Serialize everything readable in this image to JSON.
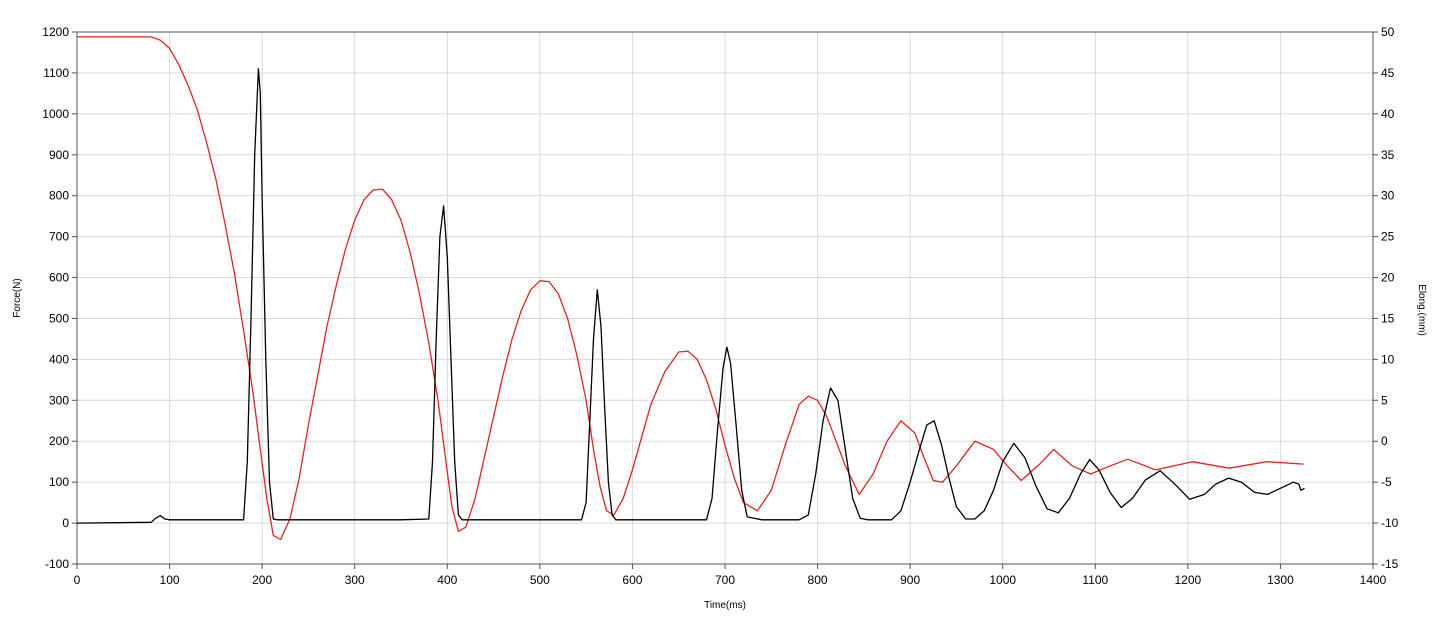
{
  "chart_data": {
    "type": "line",
    "title": "",
    "xlabel": "Time(ms)",
    "ylabel": "Force(N)",
    "y2label": "Elong.(mm)",
    "xlim": [
      0,
      1400
    ],
    "ylim": [
      -100,
      1200
    ],
    "y2lim": [
      -15,
      50
    ],
    "x_ticks": [
      "0",
      "100",
      "200",
      "300",
      "400",
      "500",
      "600",
      "700",
      "800",
      "900",
      "1000",
      "1100",
      "1200",
      "1300",
      "1400"
    ],
    "y_ticks": [
      "-100",
      "0",
      "100",
      "200",
      "300",
      "400",
      "500",
      "600",
      "700",
      "800",
      "900",
      "1000",
      "1100",
      "1200"
    ],
    "y2_ticks": [
      "-15",
      "-10",
      "-5",
      "0",
      "5",
      "10",
      "15",
      "20",
      "25",
      "30",
      "35",
      "40",
      "45",
      "50"
    ],
    "grid": true,
    "legend": "none",
    "series": [
      {
        "axis": "left",
        "color": "#000000",
        "x": [
          0,
          80,
          85,
          90,
          95,
          100,
          150,
          180,
          184,
          188,
          192,
          196,
          198,
          200,
          204,
          208,
          212,
          216,
          250,
          300,
          350,
          380,
          384,
          388,
          392,
          396,
          400,
          404,
          408,
          412,
          416,
          450,
          500,
          545,
          550,
          554,
          558,
          562,
          566,
          570,
          574,
          578,
          582,
          600,
          640,
          680,
          686,
          692,
          698,
          702,
          706,
          712,
          718,
          724,
          740,
          780,
          790,
          798,
          806,
          814,
          822,
          830,
          838,
          846,
          854,
          880,
          890,
          900,
          910,
          918,
          926,
          934,
          942,
          950,
          960,
          970,
          980,
          990,
          1000,
          1012,
          1024,
          1036,
          1048,
          1060,
          1072,
          1084,
          1094,
          1104,
          1116,
          1128,
          1140,
          1154,
          1170,
          1186,
          1202,
          1218,
          1230,
          1244,
          1258,
          1272,
          1286,
          1300,
          1314,
          1320,
          1322,
          1326
        ],
        "y": [
          0,
          2,
          12,
          18,
          10,
          8,
          8,
          8,
          150,
          500,
          900,
          1110,
          1050,
          800,
          400,
          100,
          10,
          8,
          8,
          8,
          8,
          10,
          150,
          450,
          700,
          775,
          650,
          400,
          150,
          20,
          8,
          8,
          8,
          8,
          50,
          250,
          450,
          570,
          480,
          280,
          100,
          20,
          8,
          8,
          8,
          8,
          60,
          230,
          380,
          430,
          390,
          240,
          80,
          15,
          8,
          8,
          20,
          120,
          250,
          330,
          300,
          180,
          60,
          12,
          8,
          8,
          30,
          100,
          180,
          240,
          250,
          190,
          110,
          40,
          10,
          10,
          30,
          80,
          150,
          195,
          160,
          90,
          35,
          25,
          60,
          120,
          155,
          130,
          75,
          38,
          60,
          105,
          128,
          95,
          58,
          70,
          95,
          110,
          100,
          75,
          70,
          85,
          100,
          95,
          80,
          85
        ]
      },
      {
        "axis": "right",
        "color": "#e8221e",
        "x": [
          0,
          20,
          40,
          60,
          80,
          90,
          100,
          110,
          120,
          130,
          140,
          150,
          160,
          170,
          180,
          190,
          198,
          205,
          212,
          220,
          230,
          240,
          250,
          260,
          270,
          280,
          290,
          300,
          310,
          320,
          330,
          340,
          350,
          360,
          370,
          380,
          390,
          398,
          405,
          412,
          420,
          430,
          440,
          450,
          460,
          470,
          480,
          490,
          500,
          510,
          520,
          530,
          540,
          550,
          558,
          565,
          572,
          580,
          590,
          600,
          610,
          620,
          635,
          650,
          660,
          670,
          680,
          690,
          700,
          710,
          720,
          735,
          750,
          765,
          780,
          790,
          800,
          810,
          820,
          830,
          845,
          860,
          875,
          890,
          905,
          915,
          925,
          935,
          950,
          970,
          990,
          1005,
          1020,
          1040,
          1055,
          1075,
          1095,
          1110,
          1135,
          1165,
          1205,
          1245,
          1285,
          1325
        ],
        "y": [
          49.4,
          49.4,
          49.4,
          49.4,
          49.4,
          49.0,
          48.0,
          46.0,
          43.5,
          40.5,
          36.5,
          32.0,
          26.5,
          20.5,
          13.5,
          6.0,
          -1.0,
          -7.0,
          -11.5,
          -12.0,
          -9.5,
          -4.5,
          2.0,
          8.0,
          14.0,
          19.0,
          23.5,
          27.0,
          29.5,
          30.7,
          30.8,
          29.5,
          27.0,
          23.0,
          18.0,
          12.0,
          5.0,
          -2.0,
          -8.0,
          -11.0,
          -10.5,
          -7.0,
          -2.0,
          3.0,
          8.0,
          12.5,
          16.0,
          18.5,
          19.6,
          19.5,
          18.0,
          15.0,
          10.5,
          5.0,
          -1.0,
          -5.5,
          -8.5,
          -9.0,
          -7.0,
          -3.5,
          0.5,
          4.5,
          8.5,
          10.9,
          11.0,
          10.0,
          7.5,
          4.0,
          -0.5,
          -4.5,
          -7.5,
          -8.5,
          -6.0,
          -0.5,
          4.5,
          5.5,
          5.0,
          3.0,
          0.0,
          -3.0,
          -6.5,
          -4.0,
          0.0,
          2.5,
          1.0,
          -2.0,
          -4.8,
          -5.0,
          -3.0,
          0.0,
          -1.0,
          -3.0,
          -4.8,
          -2.8,
          -1.0,
          -3.0,
          -4.0,
          -3.3,
          -2.2,
          -3.5,
          -2.5,
          -3.3,
          -2.5,
          -2.8
        ]
      }
    ]
  }
}
